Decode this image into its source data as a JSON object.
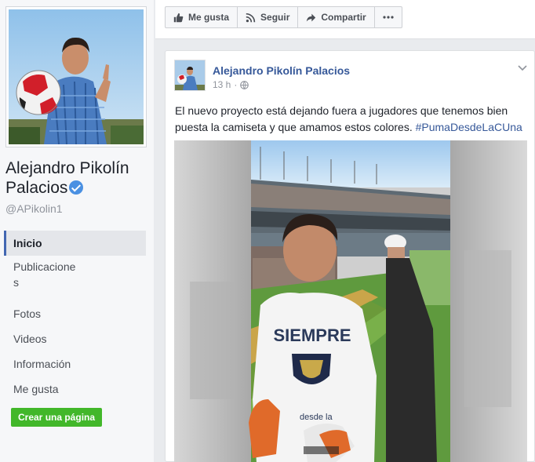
{
  "profile": {
    "name": "Alejandro Pikolín Palacios",
    "handle": "@APikolin1"
  },
  "nav": {
    "items": [
      "Inicio",
      "Publicaciones",
      "Fotos",
      "Videos",
      "Información",
      "Me gusta"
    ],
    "active_index": 0
  },
  "create_page_label": "Crear una página",
  "actions": {
    "like": "Me gusta",
    "follow": "Seguir",
    "share": "Compartir"
  },
  "post": {
    "author": "Alejandro Pikolín Palacios",
    "time": "13 h",
    "text": "El nuevo proyecto está dejando fuera a jugadores que tenemos bien puesta la camiseta y que amamos estos colores.",
    "hashtag": "#PumaDesdeLaCUna",
    "shirt_text": "SIEMPRE",
    "shirt_sub": "desde la"
  },
  "colors": {
    "link": "#365899",
    "accent": "#4267b2",
    "verified": "#4a90e2",
    "create_button": "#42b72a"
  },
  "icons": {
    "like": "thumbs-up-icon",
    "follow": "rss-icon",
    "share": "share-arrow-icon",
    "more": "more-dots-icon",
    "privacy": "globe-icon",
    "verified": "verified-badge-icon"
  }
}
